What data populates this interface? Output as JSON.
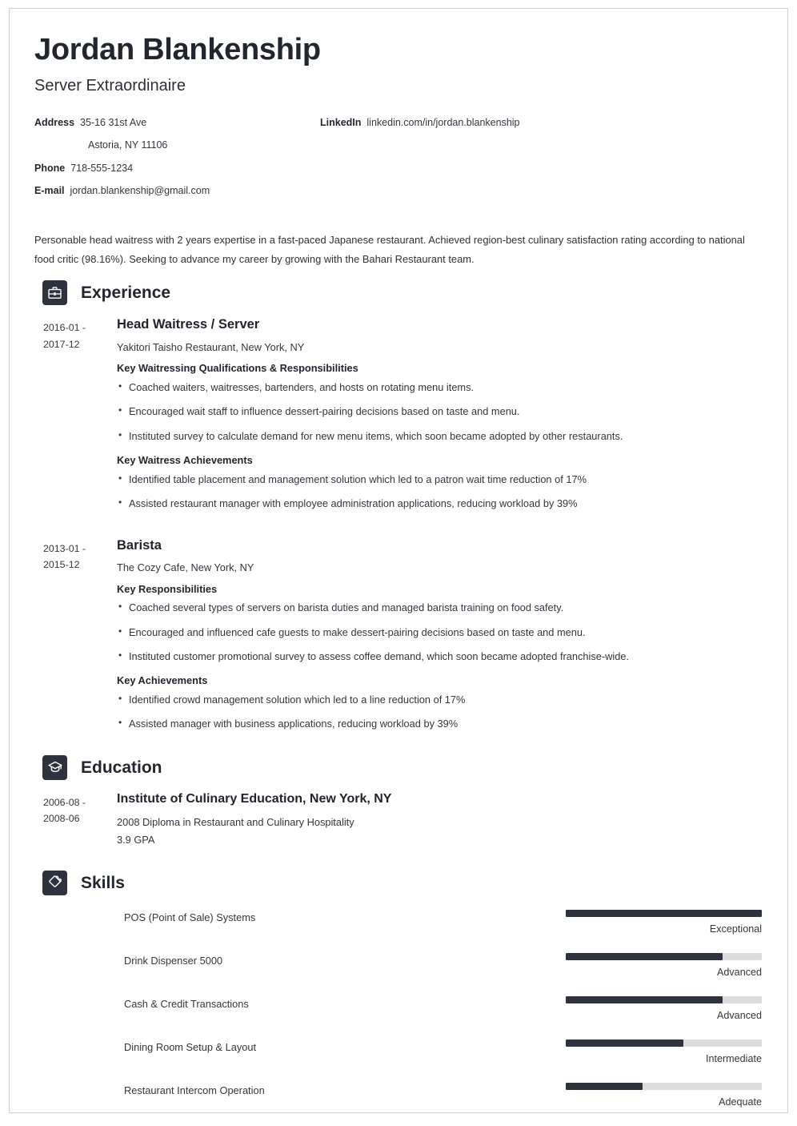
{
  "resume": {
    "name": "Jordan Blankenship",
    "job_title": "Server Extraordinaire",
    "accent_dark": "#2d323c",
    "text_color": "#32363d",
    "contact": {
      "left": [
        {
          "label": "Address",
          "value": "35-16 31st Ave",
          "value2": "Astoria, NY 11106"
        },
        {
          "label": "Phone",
          "value": "718-555-1234"
        },
        {
          "label": "E-mail",
          "value": "jordan.blankenship@gmail.com"
        }
      ],
      "right": [
        {
          "label": "LinkedIn",
          "value": "linkedin.com/in/jordan.blankenship"
        }
      ]
    },
    "summary": "Personable head waitress with 2 years expertise in a fast-paced Japanese restaurant. Achieved region-best culinary satisfaction rating according to national food critic (98.16%). Seeking to advance my career by growing with the Bahari Restaurant team.",
    "sections": {
      "experience": {
        "icon": "briefcase-icon",
        "title": "Experience",
        "entries": [
          {
            "dates_start": "2016-01 -",
            "dates_end": "2017-12",
            "title": "Head Waitress / Server",
            "subtitle": "Yakitori Taisho Restaurant, New York, NY",
            "groups": [
              {
                "label": "Key Waitressing Qualifications & Responsibilities",
                "bullets": [
                  "Coached waiters, waitresses, bartenders, and hosts on rotating menu items.",
                  "Encouraged wait staff to influence dessert-pairing decisions based on taste and menu.",
                  "Instituted survey to calculate demand for new menu items, which soon became adopted by other restaurants."
                ]
              },
              {
                "label": "Key Waitress Achievements",
                "bullets": [
                  "Identified table placement and management solution which led to a patron wait time reduction of 17%",
                  "Assisted restaurant manager with employee administration applications, reducing workload by 39%"
                ]
              }
            ]
          },
          {
            "dates_start": "2013-01 -",
            "dates_end": "2015-12",
            "title": "Barista",
            "subtitle": "The Cozy Cafe, New York, NY",
            "groups": [
              {
                "label": "Key Responsibilities",
                "bullets": [
                  "Coached several types of servers on barista duties and managed barista training on food safety.",
                  "Encouraged and influenced cafe guests to make dessert-pairing decisions based on taste and menu.",
                  "Instituted customer promotional survey to assess coffee demand, which soon became adopted franchise-wide."
                ]
              },
              {
                "label": "Key Achievements",
                "bullets": [
                  "Identified crowd management solution which led to a line reduction of 17%",
                  "Assisted manager with business applications, reducing workload by 39%"
                ]
              }
            ]
          }
        ]
      },
      "education": {
        "icon": "graduation-cap-icon",
        "title": "Education",
        "entries": [
          {
            "dates_start": "2006-08 -",
            "dates_end": "2008-06",
            "title": "Institute of Culinary Education, New York, NY",
            "line1": "2008 Diploma in Restaurant and Culinary Hospitality",
            "line2": "3.9 GPA"
          }
        ]
      },
      "skills": {
        "icon": "puzzle-piece-icon",
        "title": "Skills",
        "items": [
          {
            "name": "POS (Point of Sale) Systems",
            "level": "Exceptional",
            "percent": 100
          },
          {
            "name": "Drink Dispenser 5000",
            "level": "Advanced",
            "percent": 80
          },
          {
            "name": "Cash & Credit Transactions",
            "level": "Advanced",
            "percent": 80
          },
          {
            "name": "Dining Room Setup & Layout",
            "level": "Intermediate",
            "percent": 60
          },
          {
            "name": "Restaurant Intercom Operation",
            "level": "Adequate",
            "percent": 39
          }
        ]
      }
    }
  }
}
